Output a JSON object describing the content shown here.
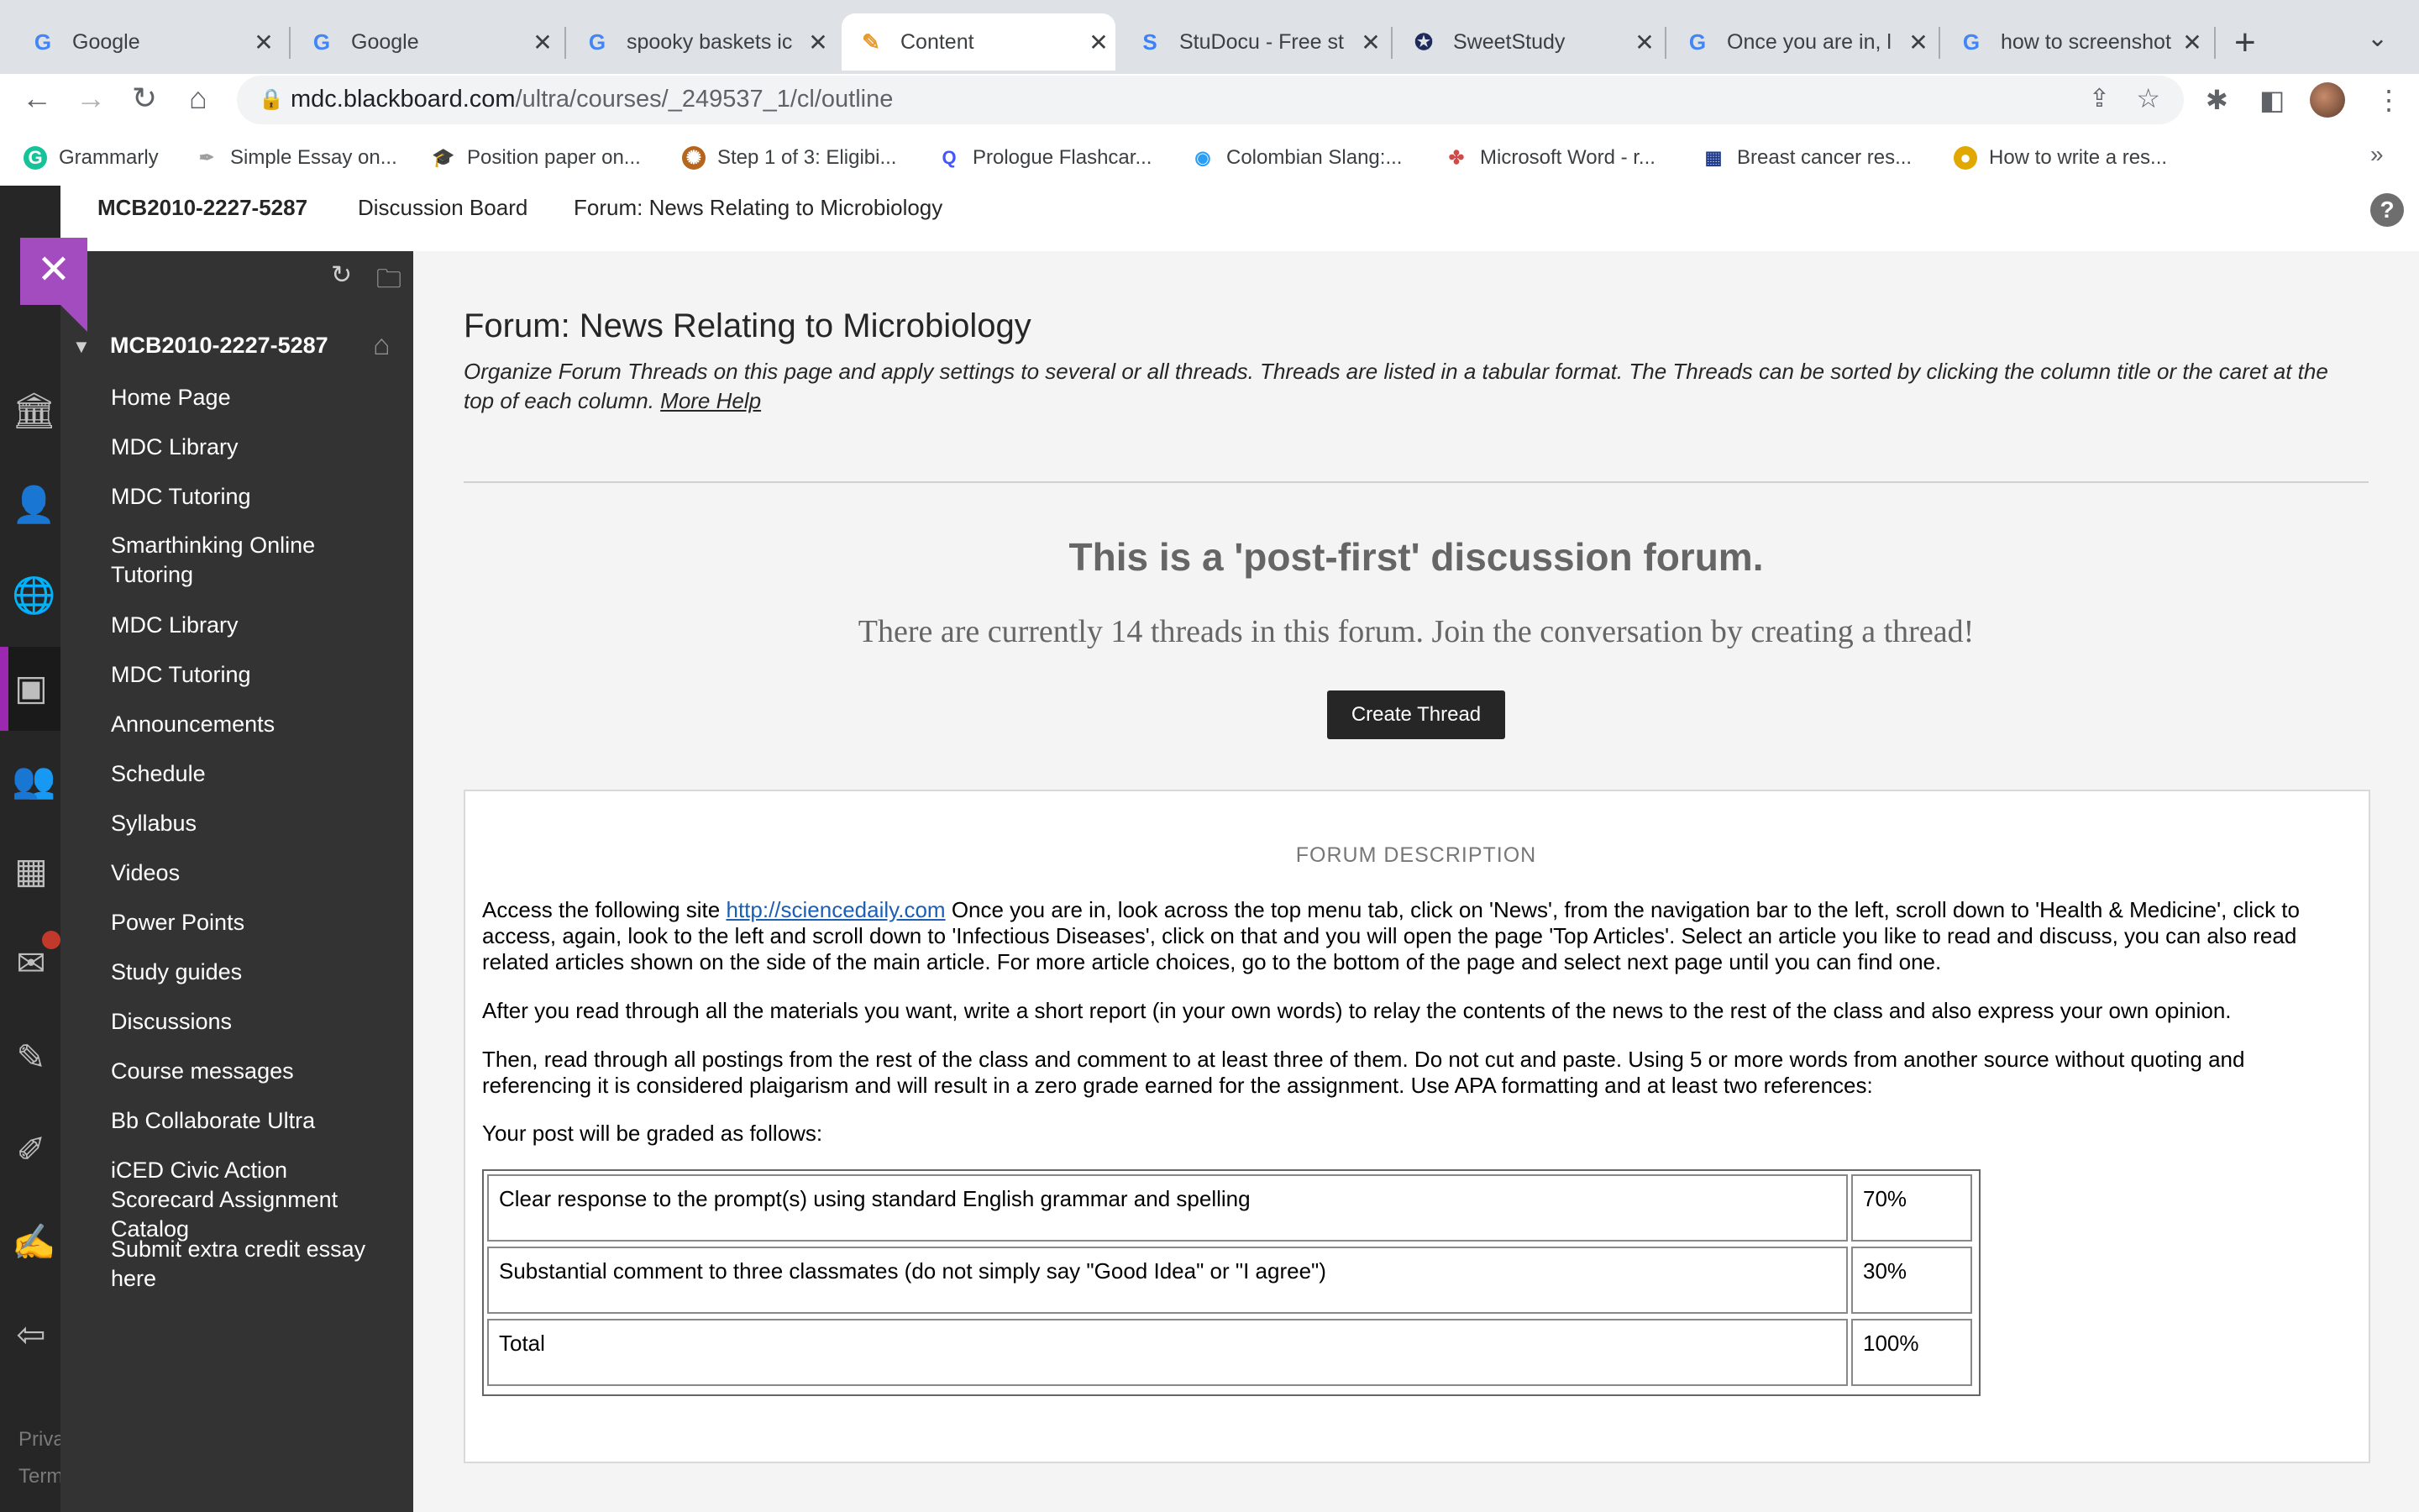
{
  "browser": {
    "tabs": [
      {
        "title": "Google",
        "icon": "google-icon"
      },
      {
        "title": "Google",
        "icon": "google-icon"
      },
      {
        "title": "spooky baskets ic",
        "icon": "google-icon"
      },
      {
        "title": "Content",
        "icon": "blackboard-icon",
        "active": true
      },
      {
        "title": "StuDocu - Free st",
        "icon": "studocu-icon"
      },
      {
        "title": "SweetStudy",
        "icon": "sweetstudy-icon"
      },
      {
        "title": "Once you are in, l",
        "icon": "google-icon"
      },
      {
        "title": "how to screenshot",
        "icon": "google-icon"
      }
    ],
    "url_host": "mdc.blackboard.com",
    "url_path": "/ultra/courses/_249537_1/cl/outline",
    "bookmarks": [
      {
        "label": "Grammarly",
        "icon": "grammarly-icon",
        "color": "#15c39a"
      },
      {
        "label": "Simple Essay on...",
        "icon": "feather-icon",
        "color": "#9e9e9e"
      },
      {
        "label": "Position paper on...",
        "icon": "graduation-cap-icon",
        "color": "#6a3fa0"
      },
      {
        "label": "Step 1 of 3: Eligibi...",
        "icon": "seal-icon",
        "color": "#b5651d"
      },
      {
        "label": "Prologue Flashcar...",
        "icon": "quizlet-icon",
        "color": "#4255ff"
      },
      {
        "label": "Colombian Slang:...",
        "icon": "globe-eye-icon",
        "color": "#2a9df4"
      },
      {
        "label": "Microsoft Word - r...",
        "icon": "windmill-icon",
        "color": "#d04a4a"
      },
      {
        "label": "Breast cancer res...",
        "icon": "grid-icon",
        "color": "#1f3b8c"
      },
      {
        "label": "How to write a res...",
        "icon": "coin-icon",
        "color": "#e0a800"
      }
    ],
    "bookmarks_more": "»"
  },
  "header": {
    "breadcrumbs": [
      "MCB2010-2227-5287",
      "Discussion Board",
      "Forum: News Relating to Microbiology"
    ],
    "help": "?"
  },
  "rail": {
    "footer": [
      "Priva",
      "Term"
    ]
  },
  "course_menu": {
    "course_title": "MCB2010-2227-5287",
    "items": [
      "Home Page",
      "MDC Library",
      "MDC Tutoring",
      "Smarthinking Online Tutoring",
      "MDC Library",
      "MDC Tutoring",
      "Announcements",
      "Schedule",
      "Syllabus",
      "Videos",
      "Power Points",
      "Study guides",
      "Discussions",
      "Course messages",
      "Bb Collaborate Ultra",
      "iCED Civic Action Scorecard Assignment Catalog",
      "Submit extra credit essay here"
    ]
  },
  "forum": {
    "title": "Forum: News Relating to Microbiology",
    "description": "Organize Forum Threads on this page and apply settings to several or all threads. Threads are listed in a tabular format. The Threads can be sorted by clicking the column title or the caret at the top of each column.",
    "more_help": "More Help",
    "post_first": "This is a 'post-first' discussion forum.",
    "thread_count": "There are currently 14 threads in this forum. Join the conversation by creating a thread!",
    "create_thread": "Create Thread",
    "desc_heading": "FORUM DESCRIPTION",
    "para1_pre": "Access the following site",
    "para1_link": "http://sciencedaily.com",
    "para1_post": " Once you are in, look across the top menu tab, click on 'News', from the navigation bar to the left, scroll down to 'Health & Medicine', click to access, again, look to the left and scroll down to 'Infectious Diseases', click on that and you will open the page 'Top Articles'. Select an article you like to read and discuss, you can also read related articles shown on the side of the main article. For more article choices, go to the bottom of the page and select next page until you can find one.",
    "para2": "After you read through all the materials you want, write a short report (in your own words) to relay the contents of the news to the rest of the class and also express your own opinion.",
    "para3": "Then, read through all postings from the rest of the class and comment to at least three of them. Do not cut and paste. Using 5 or more words from another source without quoting and referencing it is considered plaigarism and will result in a zero grade earned for the assignment. Use APA formatting and at least two references:",
    "para4": "Your post will be graded as follows:",
    "grading": [
      {
        "criterion": "Clear response to the prompt(s) using standard English grammar and spelling",
        "weight": "70%"
      },
      {
        "criterion": "Substantial comment to three classmates (do not simply say \"Good Idea\" or \"I agree\")",
        "weight": "30%"
      },
      {
        "criterion": "Total",
        "weight": "100%"
      }
    ]
  }
}
